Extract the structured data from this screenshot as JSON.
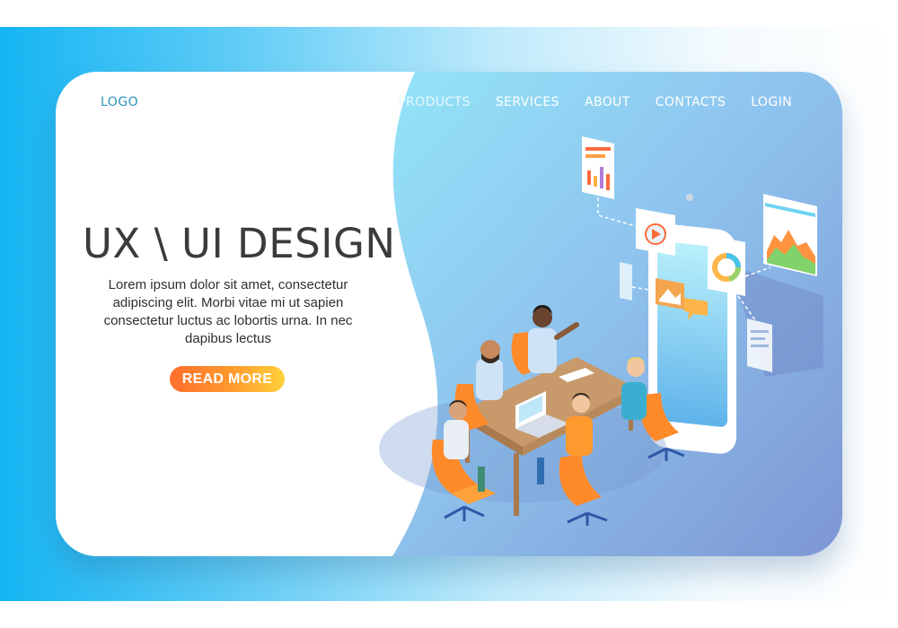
{
  "header": {
    "logo": "LOGO",
    "nav": [
      "PRODUCTS",
      "SERVICES",
      "ABOUT",
      "CONTACTS",
      "LOGIN"
    ]
  },
  "hero": {
    "title": "UX \\ UI DESIGN",
    "description": "Lorem ipsum dolor sit amet, consectetur adipiscing elit. Morbi vitae mi ut sapien consectetur luctus ac lobortis urna. In nec dapibus lectus",
    "cta_label": "READ MORE"
  },
  "colors": {
    "accent_blue": "#14b5f3",
    "button_start": "#ff6f2c",
    "button_end": "#ffd13a",
    "title": "#3d3b3a"
  },
  "illustration": {
    "icons": [
      "smartphone-icon",
      "play-icon",
      "donut-chart-icon",
      "area-chart-icon",
      "bar-chart-icon",
      "chat-icon",
      "image-icon",
      "laptop-icon",
      "meeting-table-icon"
    ]
  }
}
